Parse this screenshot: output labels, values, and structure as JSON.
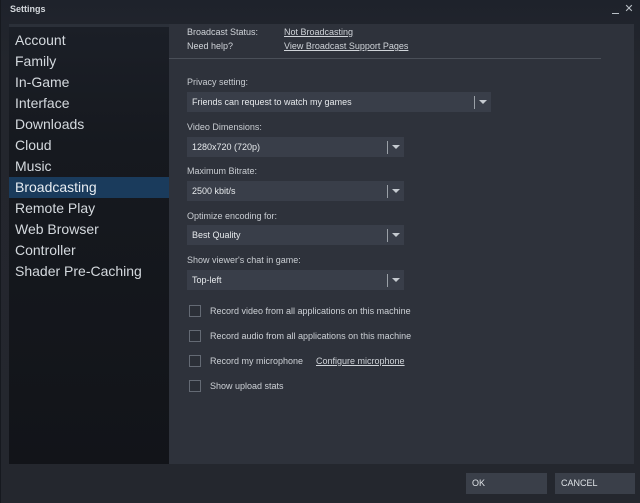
{
  "window": {
    "title": "Settings",
    "minimize_glyph": "",
    "close_glyph": "✕"
  },
  "sidebar": {
    "items": [
      {
        "label": "Account"
      },
      {
        "label": "Family"
      },
      {
        "label": "In-Game"
      },
      {
        "label": "Interface"
      },
      {
        "label": "Downloads"
      },
      {
        "label": "Cloud"
      },
      {
        "label": "Music"
      },
      {
        "label": "Broadcasting",
        "active": true
      },
      {
        "label": "Remote Play"
      },
      {
        "label": "Web Browser"
      },
      {
        "label": "Controller"
      },
      {
        "label": "Shader Pre-Caching"
      }
    ]
  },
  "broadcast": {
    "status_label": "Broadcast Status:",
    "status_value": "Not Broadcasting",
    "help_label": "Need help?",
    "help_link": "View Broadcast Support Pages"
  },
  "settings": {
    "privacy": {
      "label": "Privacy setting:",
      "value": "Friends can request to watch my games"
    },
    "video_dimensions": {
      "label": "Video Dimensions:",
      "value": "1280x720 (720p)"
    },
    "max_bitrate": {
      "label": "Maximum Bitrate:",
      "value": "2500 kbit/s"
    },
    "optimize": {
      "label": "Optimize encoding for:",
      "value": "Best Quality"
    },
    "chat_position": {
      "label": "Show viewer's chat in game:",
      "value": "Top-left"
    }
  },
  "checkboxes": [
    {
      "label": "Record video from all applications on this machine",
      "checked": false
    },
    {
      "label": "Record audio from all applications on this machine",
      "checked": false
    },
    {
      "label": "Record my microphone",
      "checked": false,
      "link": "Configure microphone"
    },
    {
      "label": "Show upload stats",
      "checked": false
    }
  ],
  "footer": {
    "ok_label": "OK",
    "cancel_label": "CANCEL"
  },
  "colors": {
    "active_nav": "#1a3b5c",
    "content_bg": "#2e323b",
    "sidebar_bg": "#16191f"
  }
}
